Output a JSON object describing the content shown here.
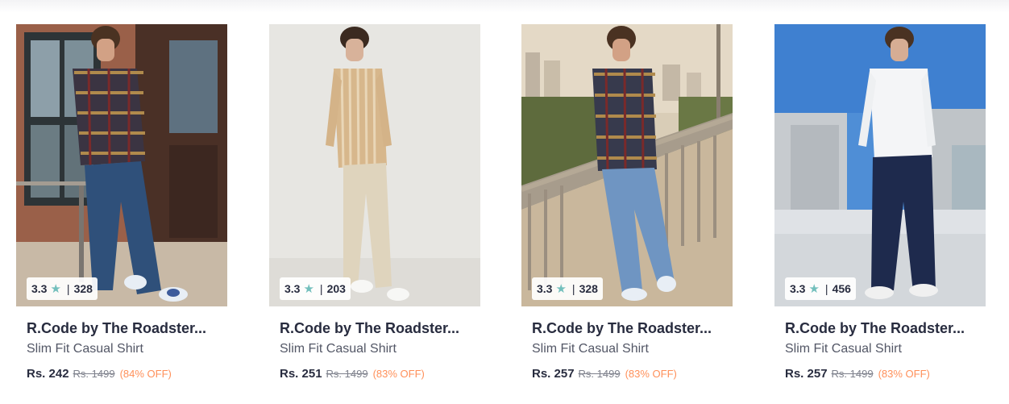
{
  "products": [
    {
      "brand": "R.Code by The Roadster...",
      "subtitle": "Slim Fit Casual Shirt",
      "price": "Rs. 242",
      "mrp": "Rs. 1499",
      "discount": "(84% OFF)",
      "rating": "3.3",
      "rating_count": "328"
    },
    {
      "brand": "R.Code by The Roadster...",
      "subtitle": "Slim Fit Casual Shirt",
      "price": "Rs. 251",
      "mrp": "Rs. 1499",
      "discount": "(83% OFF)",
      "rating": "3.3",
      "rating_count": "203"
    },
    {
      "brand": "R.Code by The Roadster...",
      "subtitle": "Slim Fit Casual Shirt",
      "price": "Rs. 257",
      "mrp": "Rs. 1499",
      "discount": "(83% OFF)",
      "rating": "3.3",
      "rating_count": "328"
    },
    {
      "brand": "R.Code by The Roadster...",
      "subtitle": "Slim Fit Casual Shirt",
      "price": "Rs. 257",
      "mrp": "Rs. 1499",
      "discount": "(83% OFF)",
      "rating": "3.3",
      "rating_count": "456"
    }
  ],
  "icons": {
    "rating": "star-icon"
  },
  "colors": {
    "star": "#72bfbc",
    "discount": "#ff905a",
    "text_primary": "#282c3f",
    "text_secondary": "#535766",
    "mrp": "#7e818c"
  }
}
